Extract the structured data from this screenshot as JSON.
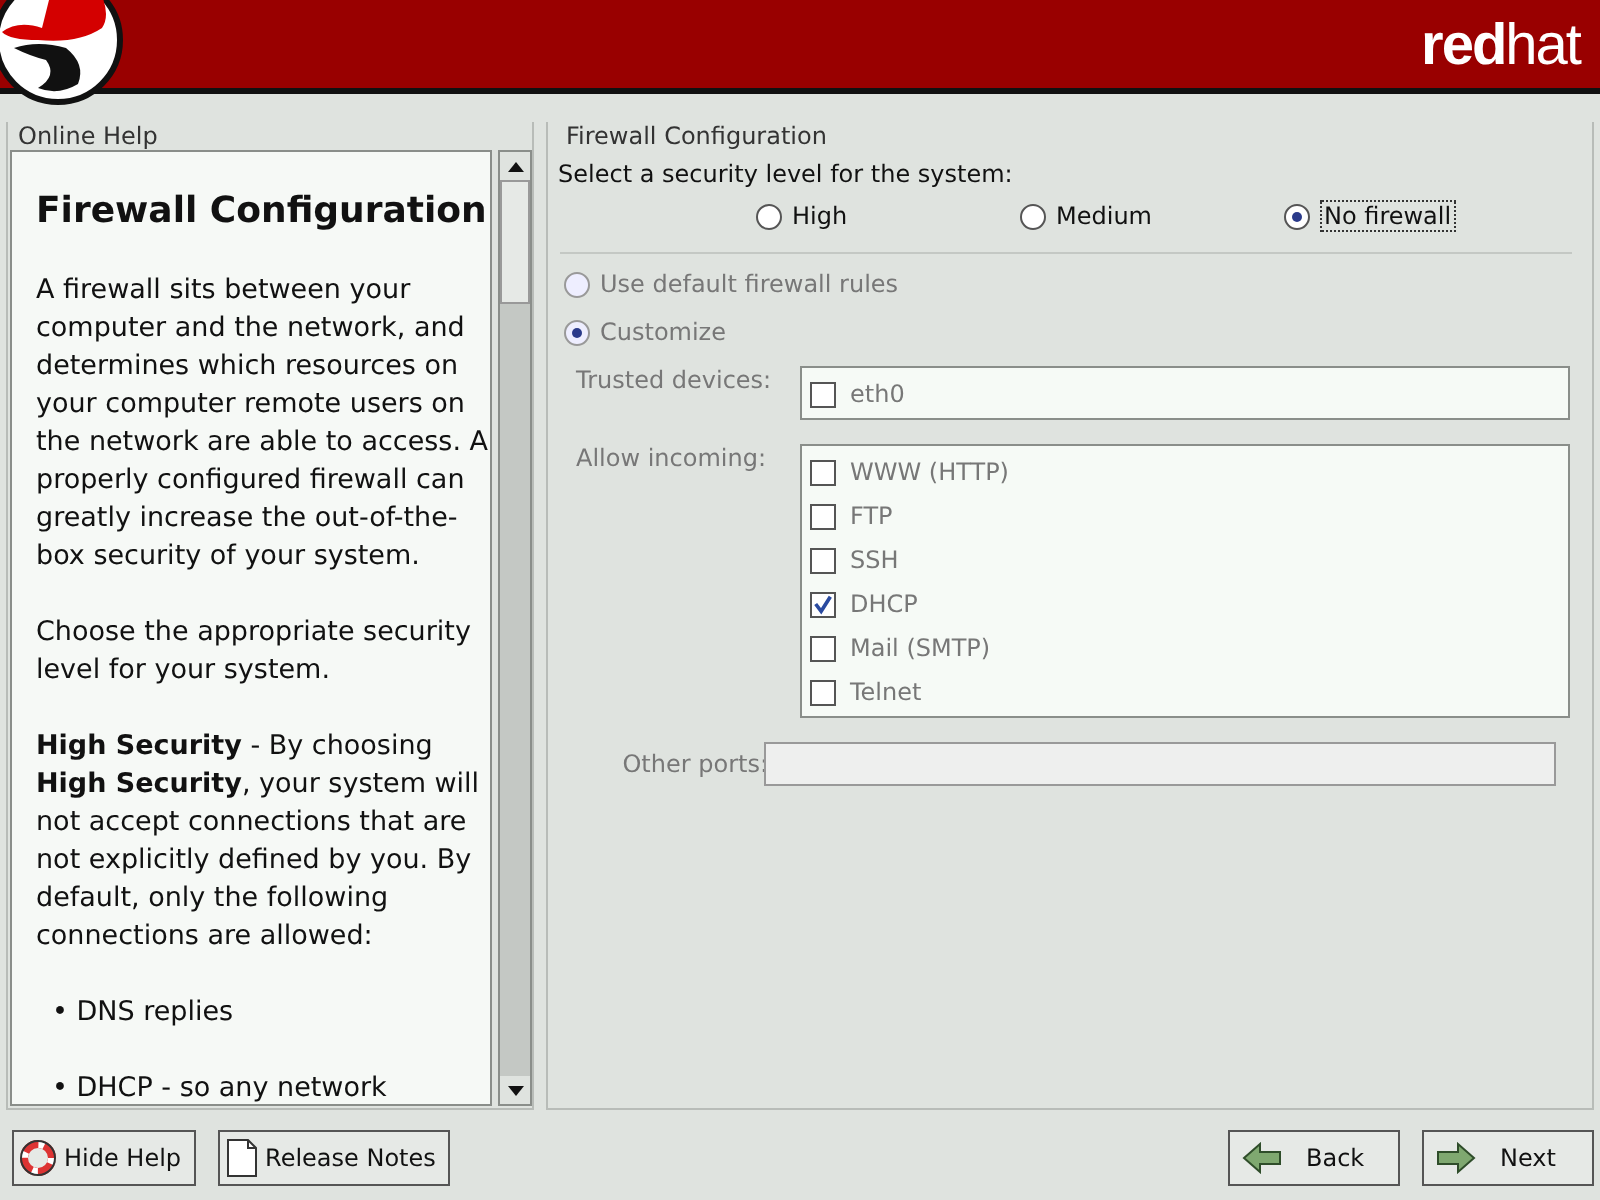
{
  "header": {
    "brand": "**red**hat"
  },
  "help": {
    "title": "Online Help",
    "heading": "Firewall Configuration",
    "paragraphs": [
      "A firewall sits between your computer and the network, and determines which resources on your computer remote users on the network are able to access. A properly configured firewall can greatly increase the out-of-the-box security of your system.",
      "Choose the appropriate security level for your system.",
      "**High Security** - By choosing **High Security**, your system will not accept connections that are not explicitly defined by you. By default, only the following connections are allowed:"
    ],
    "bullets": [
      "• DNS replies",
      "• DHCP - so any network"
    ]
  },
  "firewall": {
    "title": "Firewall Configuration",
    "prompt": "Select a security level for the system:",
    "levels": [
      {
        "label": "High",
        "selected": false
      },
      {
        "label": "Medium",
        "selected": false
      },
      {
        "label": "No firewall",
        "selected": true
      }
    ],
    "customize": {
      "disabled": true,
      "rules": [
        {
          "label": "Use default firewall rules",
          "selected": false
        },
        {
          "label": "Customize",
          "selected": true
        }
      ],
      "trusted_devices": {
        "label": "Trusted devices:",
        "items": [
          {
            "label": "eth0",
            "checked": false
          }
        ]
      },
      "allow_incoming": {
        "label": "Allow incoming:",
        "items": [
          {
            "label": "WWW (HTTP)",
            "checked": false
          },
          {
            "label": "FTP",
            "checked": false
          },
          {
            "label": "SSH",
            "checked": false
          },
          {
            "label": "DHCP",
            "checked": true
          },
          {
            "label": "Mail (SMTP)",
            "checked": false
          },
          {
            "label": "Telnet",
            "checked": false
          }
        ]
      },
      "other_ports": {
        "label": "Other ports:"
      }
    }
  },
  "buttons": [
    {
      "label": "Hide Help",
      "kind": "help"
    },
    {
      "label": "Release Notes",
      "kind": "notes"
    },
    {
      "label": "Back",
      "kind": "back"
    },
    {
      "label": "Next",
      "kind": "next"
    }
  ]
}
